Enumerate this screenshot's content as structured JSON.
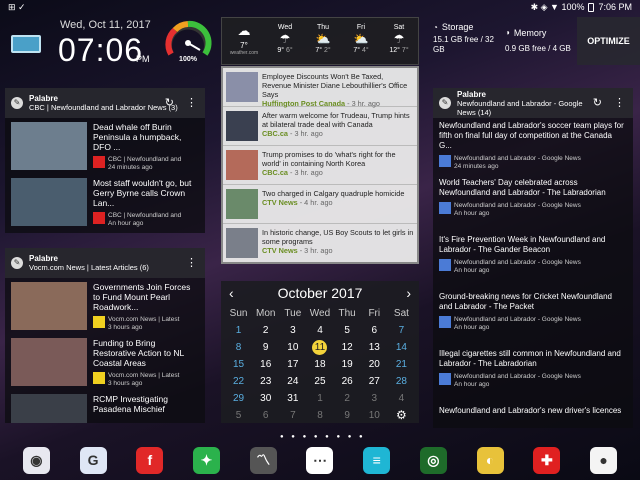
{
  "status": {
    "left": "⊞ ✓",
    "right": "✱ ◈ ▼ 100%",
    "time": "7:06 PM"
  },
  "clock": {
    "date": "Wed, Oct 11, 2017",
    "time": "07:06",
    "ampm": "PM",
    "battery": "100%"
  },
  "weather": {
    "current": {
      "temp": "7°",
      "source": "weather.com"
    },
    "days": [
      {
        "name": "Wed",
        "icon": "☂",
        "hi": "9°",
        "lo": "6°"
      },
      {
        "name": "Thu",
        "icon": "⛅",
        "hi": "7°",
        "lo": "2°"
      },
      {
        "name": "Fri",
        "icon": "⛅",
        "hi": "7°",
        "lo": "4°"
      },
      {
        "name": "Sat",
        "icon": "☂",
        "hi": "12°",
        "lo": "7°"
      }
    ]
  },
  "storage": {
    "label": "Storage",
    "value": "15.1 GB free / 32 GB",
    "mem_label": "Memory",
    "mem_value": "0.9 GB free / 4 GB",
    "optimize": "OPTIMIZE"
  },
  "news": [
    {
      "title": "Employee Discounts Won't Be Taxed, Revenue Minister Diane Lebouthillier's Office Says",
      "src": "Huffington Post Canada",
      "ago": " - 3 hr. ago"
    },
    {
      "title": "After warm welcome for Trudeau, Trump hints at bilateral trade deal with Canada",
      "src": "CBC.ca",
      "ago": " - 3 hr. ago"
    },
    {
      "title": "Trump promises to do 'what's right for the world' in containing North Korea",
      "src": "CBC.ca",
      "ago": " - 3 hr. ago"
    },
    {
      "title": "Two charged in Calgary quadruple homicide",
      "src": "CTV News",
      "ago": " - 4 hr. ago"
    },
    {
      "title": "In historic change, US Boy Scouts to let girls in some programs",
      "src": "CTV News",
      "ago": " - 3 hr. ago"
    }
  ],
  "cbc": {
    "title": "Palabre",
    "sub": "CBC | Newfoundland and Labrador News (3)",
    "items": [
      {
        "title": "Dead whale off Burin Peninsula a humpback, DFO ...",
        "src": "CBC | Newfoundland and",
        "ago": "24 minutes ago"
      },
      {
        "title": "Most staff wouldn't go, but Gerry Byrne calls Crown Lan...",
        "src": "CBC | Newfoundland and",
        "ago": "An hour ago"
      }
    ]
  },
  "vocm": {
    "title": "Palabre",
    "sub": "Vocm.com News | Latest Articles (6)",
    "items": [
      {
        "title": "Governments Join Forces to Fund Mount Pearl Roadwork...",
        "src": "Vocm.com News | Latest",
        "ago": "3 hours ago"
      },
      {
        "title": "Funding to Bring Restorative Action to NL Coastal Areas",
        "src": "Vocm.com News | Latest",
        "ago": "3 hours ago"
      },
      {
        "title": "RCMP Investigating Pasadena Mischief",
        "src": "",
        "ago": ""
      }
    ]
  },
  "google": {
    "title": "Palabre",
    "sub": "Newfoundland and Labrador - Google News (14)",
    "items": [
      {
        "title": "Newfoundland and Labrador's soccer team plays for fifth on final full day of competition at the Canada G...",
        "src": "Newfoundland and Labrador - Google News",
        "ago": "24 minutes ago"
      },
      {
        "title": "World Teachers' Day celebrated across Newfoundland and Labrador - The Labradorian",
        "src": "Newfoundland and Labrador - Google News",
        "ago": "An hour ago"
      },
      {
        "title": "It's Fire Prevention Week in Newfoundland and Labrador - The Gander Beacon",
        "src": "Newfoundland and Labrador - Google News",
        "ago": "An hour ago"
      },
      {
        "title": "Ground-breaking news for Cricket Newfoundland and Labrador - The Packet",
        "src": "Newfoundland and Labrador - Google News",
        "ago": "An hour ago"
      },
      {
        "title": "Illegal cigarettes still common in Newfoundland and Labrador - The Labradorian",
        "src": "Newfoundland and Labrador - Google News",
        "ago": "An hour ago"
      },
      {
        "title": "Newfoundland and Labrador's new driver's licences",
        "src": "",
        "ago": ""
      }
    ]
  },
  "calendar": {
    "month": "October 2017",
    "prev": "‹",
    "next": "›",
    "weekdays": [
      "Sun",
      "Mon",
      "Tue",
      "Wed",
      "Thu",
      "Fri",
      "Sat"
    ],
    "days": [
      "1",
      "2",
      "3",
      "4",
      "5",
      "6",
      "7",
      "8",
      "9",
      "10",
      "11",
      "12",
      "13",
      "14",
      "15",
      "16",
      "17",
      "18",
      "19",
      "20",
      "21",
      "22",
      "23",
      "24",
      "25",
      "26",
      "27",
      "28",
      "29",
      "30",
      "31",
      "1",
      "2",
      "3",
      "4",
      "5",
      "6",
      "7",
      "8",
      "9",
      "10",
      "⚙"
    ],
    "today": "11"
  },
  "dock": [
    {
      "name": "camera",
      "g": "◉",
      "c": "#e8e8f0"
    },
    {
      "name": "calendar-app",
      "g": "G",
      "c": "#dfe6f5"
    },
    {
      "name": "flipboard",
      "g": "f",
      "c": "#e12828"
    },
    {
      "name": "feedly",
      "g": "✦",
      "c": "#2bb24c"
    },
    {
      "name": "pulse",
      "g": "〽",
      "c": "#555"
    },
    {
      "name": "apps",
      "g": "⋯",
      "c": "#fff"
    },
    {
      "name": "tasks",
      "g": "≡",
      "c": "#1fb6d4"
    },
    {
      "name": "radar",
      "g": "◎",
      "c": "#1e6b2a"
    },
    {
      "name": "globe",
      "g": "◐",
      "c": "#e8c23a"
    },
    {
      "name": "canada",
      "g": "✚",
      "c": "#e02020"
    },
    {
      "name": "chrome",
      "g": "●",
      "c": "#f4f4f4"
    }
  ],
  "dots": "● ● ● ● ● ● ● ●"
}
